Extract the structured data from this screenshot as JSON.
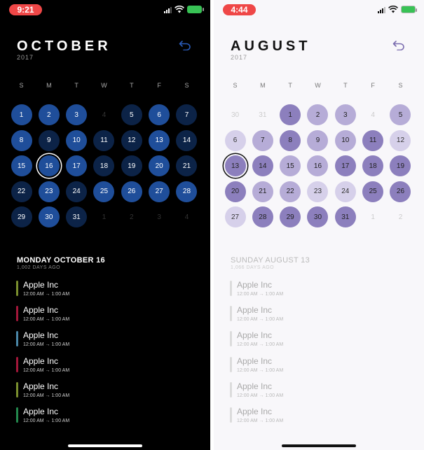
{
  "left_screen": {
    "status": {
      "time": "9:21"
    },
    "month": "OCTOBER",
    "year": "2017",
    "weekdays": [
      "S",
      "M",
      "T",
      "W",
      "T",
      "F",
      "S"
    ],
    "days": [
      {
        "n": "1",
        "s": "blue"
      },
      {
        "n": "2",
        "s": "blue"
      },
      {
        "n": "3",
        "s": "blue"
      },
      {
        "n": "4",
        "s": "dim"
      },
      {
        "n": "5",
        "s": "navy"
      },
      {
        "n": "6",
        "s": "blue"
      },
      {
        "n": "7",
        "s": "navy"
      },
      {
        "n": "8",
        "s": "blue"
      },
      {
        "n": "9",
        "s": "navy"
      },
      {
        "n": "10",
        "s": "blue"
      },
      {
        "n": "11",
        "s": "navy"
      },
      {
        "n": "12",
        "s": "navy"
      },
      {
        "n": "13",
        "s": "blue"
      },
      {
        "n": "14",
        "s": "navy"
      },
      {
        "n": "15",
        "s": "blue"
      },
      {
        "n": "16",
        "s": "blue sel"
      },
      {
        "n": "17",
        "s": "blue"
      },
      {
        "n": "18",
        "s": "navy"
      },
      {
        "n": "19",
        "s": "navy"
      },
      {
        "n": "20",
        "s": "blue"
      },
      {
        "n": "21",
        "s": "navy"
      },
      {
        "n": "22",
        "s": "navy"
      },
      {
        "n": "23",
        "s": "blue"
      },
      {
        "n": "24",
        "s": "navy"
      },
      {
        "n": "25",
        "s": "blue"
      },
      {
        "n": "26",
        "s": "blue"
      },
      {
        "n": "27",
        "s": "blue"
      },
      {
        "n": "28",
        "s": "blue"
      },
      {
        "n": "29",
        "s": "navy"
      },
      {
        "n": "30",
        "s": "blue"
      },
      {
        "n": "31",
        "s": "navy"
      },
      {
        "n": "1",
        "s": "dim"
      },
      {
        "n": "2",
        "s": "dim"
      },
      {
        "n": "3",
        "s": "dim"
      },
      {
        "n": "4",
        "s": "dim"
      }
    ],
    "selected_date": "MONDAY OCTOBER 16",
    "days_ago": "1,002 DAYS AGO",
    "events": [
      {
        "name": "Apple Inc",
        "time": "12:00 AM → 1:00 AM",
        "color": "#7a8f2e"
      },
      {
        "name": "Apple Inc",
        "time": "12:00 AM → 1:00 AM",
        "color": "#a3173a"
      },
      {
        "name": "Apple Inc",
        "time": "12:00 AM → 1:00 AM",
        "color": "#4a87a8"
      },
      {
        "name": "Apple Inc",
        "time": "12:00 AM → 1:00 AM",
        "color": "#a3173a"
      },
      {
        "name": "Apple Inc",
        "time": "12:00 AM → 1:00 AM",
        "color": "#7a8f2e"
      },
      {
        "name": "Apple Inc",
        "time": "12:00 AM → 1:00 AM",
        "color": "#23884d"
      }
    ]
  },
  "right_screen": {
    "status": {
      "time": "4:44"
    },
    "month": "AUGUST",
    "year": "2017",
    "weekdays": [
      "S",
      "M",
      "T",
      "W",
      "T",
      "F",
      "S"
    ],
    "days": [
      {
        "n": "30",
        "s": "dim"
      },
      {
        "n": "31",
        "s": "dim"
      },
      {
        "n": "1",
        "s": "p1"
      },
      {
        "n": "2",
        "s": "p2"
      },
      {
        "n": "3",
        "s": "p2"
      },
      {
        "n": "4",
        "s": "dim"
      },
      {
        "n": "5",
        "s": "p2"
      },
      {
        "n": "6",
        "s": "p3"
      },
      {
        "n": "7",
        "s": "p2"
      },
      {
        "n": "8",
        "s": "p1"
      },
      {
        "n": "9",
        "s": "p2"
      },
      {
        "n": "10",
        "s": "p2"
      },
      {
        "n": "11",
        "s": "p1"
      },
      {
        "n": "12",
        "s": "p3"
      },
      {
        "n": "13",
        "s": "p1 sel"
      },
      {
        "n": "14",
        "s": "p1"
      },
      {
        "n": "15",
        "s": "p2"
      },
      {
        "n": "16",
        "s": "p2"
      },
      {
        "n": "17",
        "s": "p1"
      },
      {
        "n": "18",
        "s": "p1"
      },
      {
        "n": "19",
        "s": "p1"
      },
      {
        "n": "20",
        "s": "p1"
      },
      {
        "n": "21",
        "s": "p2"
      },
      {
        "n": "22",
        "s": "p2"
      },
      {
        "n": "23",
        "s": "p3"
      },
      {
        "n": "24",
        "s": "p3"
      },
      {
        "n": "25",
        "s": "p1"
      },
      {
        "n": "26",
        "s": "p1"
      },
      {
        "n": "27",
        "s": "p3"
      },
      {
        "n": "28",
        "s": "p1"
      },
      {
        "n": "29",
        "s": "p1"
      },
      {
        "n": "30",
        "s": "p1"
      },
      {
        "n": "31",
        "s": "p1"
      },
      {
        "n": "1",
        "s": "dim"
      },
      {
        "n": "2",
        "s": "dim"
      }
    ],
    "selected_date": "SUNDAY AUGUST 13",
    "days_ago": "1,066 DAYS AGO",
    "events": [
      {
        "name": "Apple Inc",
        "time": "12:00 AM → 1:00 AM",
        "color": "#dcdcdc"
      },
      {
        "name": "Apple Inc",
        "time": "12:00 AM → 1:00 AM",
        "color": "#dcdcdc"
      },
      {
        "name": "Apple Inc",
        "time": "12:00 AM → 1:00 AM",
        "color": "#dcdcdc"
      },
      {
        "name": "Apple Inc",
        "time": "12:00 AM → 1:00 AM",
        "color": "#dcdcdc"
      },
      {
        "name": "Apple Inc",
        "time": "12:00 AM → 1:00 AM",
        "color": "#dcdcdc"
      },
      {
        "name": "Apple Inc",
        "time": "12:00 AM → 1:00 AM",
        "color": "#dcdcdc"
      }
    ]
  },
  "icons": {
    "undo": "undo-icon",
    "wifi": "wifi-icon",
    "battery": "battery-icon",
    "signal": "signal-icon"
  },
  "colors": {
    "dark_blue": "#1f4e9a",
    "dark_navy": "#0c2347",
    "purple": "#8c7fbd",
    "lavender": "#b6acd7",
    "pale_lavender": "#d6d0ea",
    "status_red": "#ef4747"
  }
}
